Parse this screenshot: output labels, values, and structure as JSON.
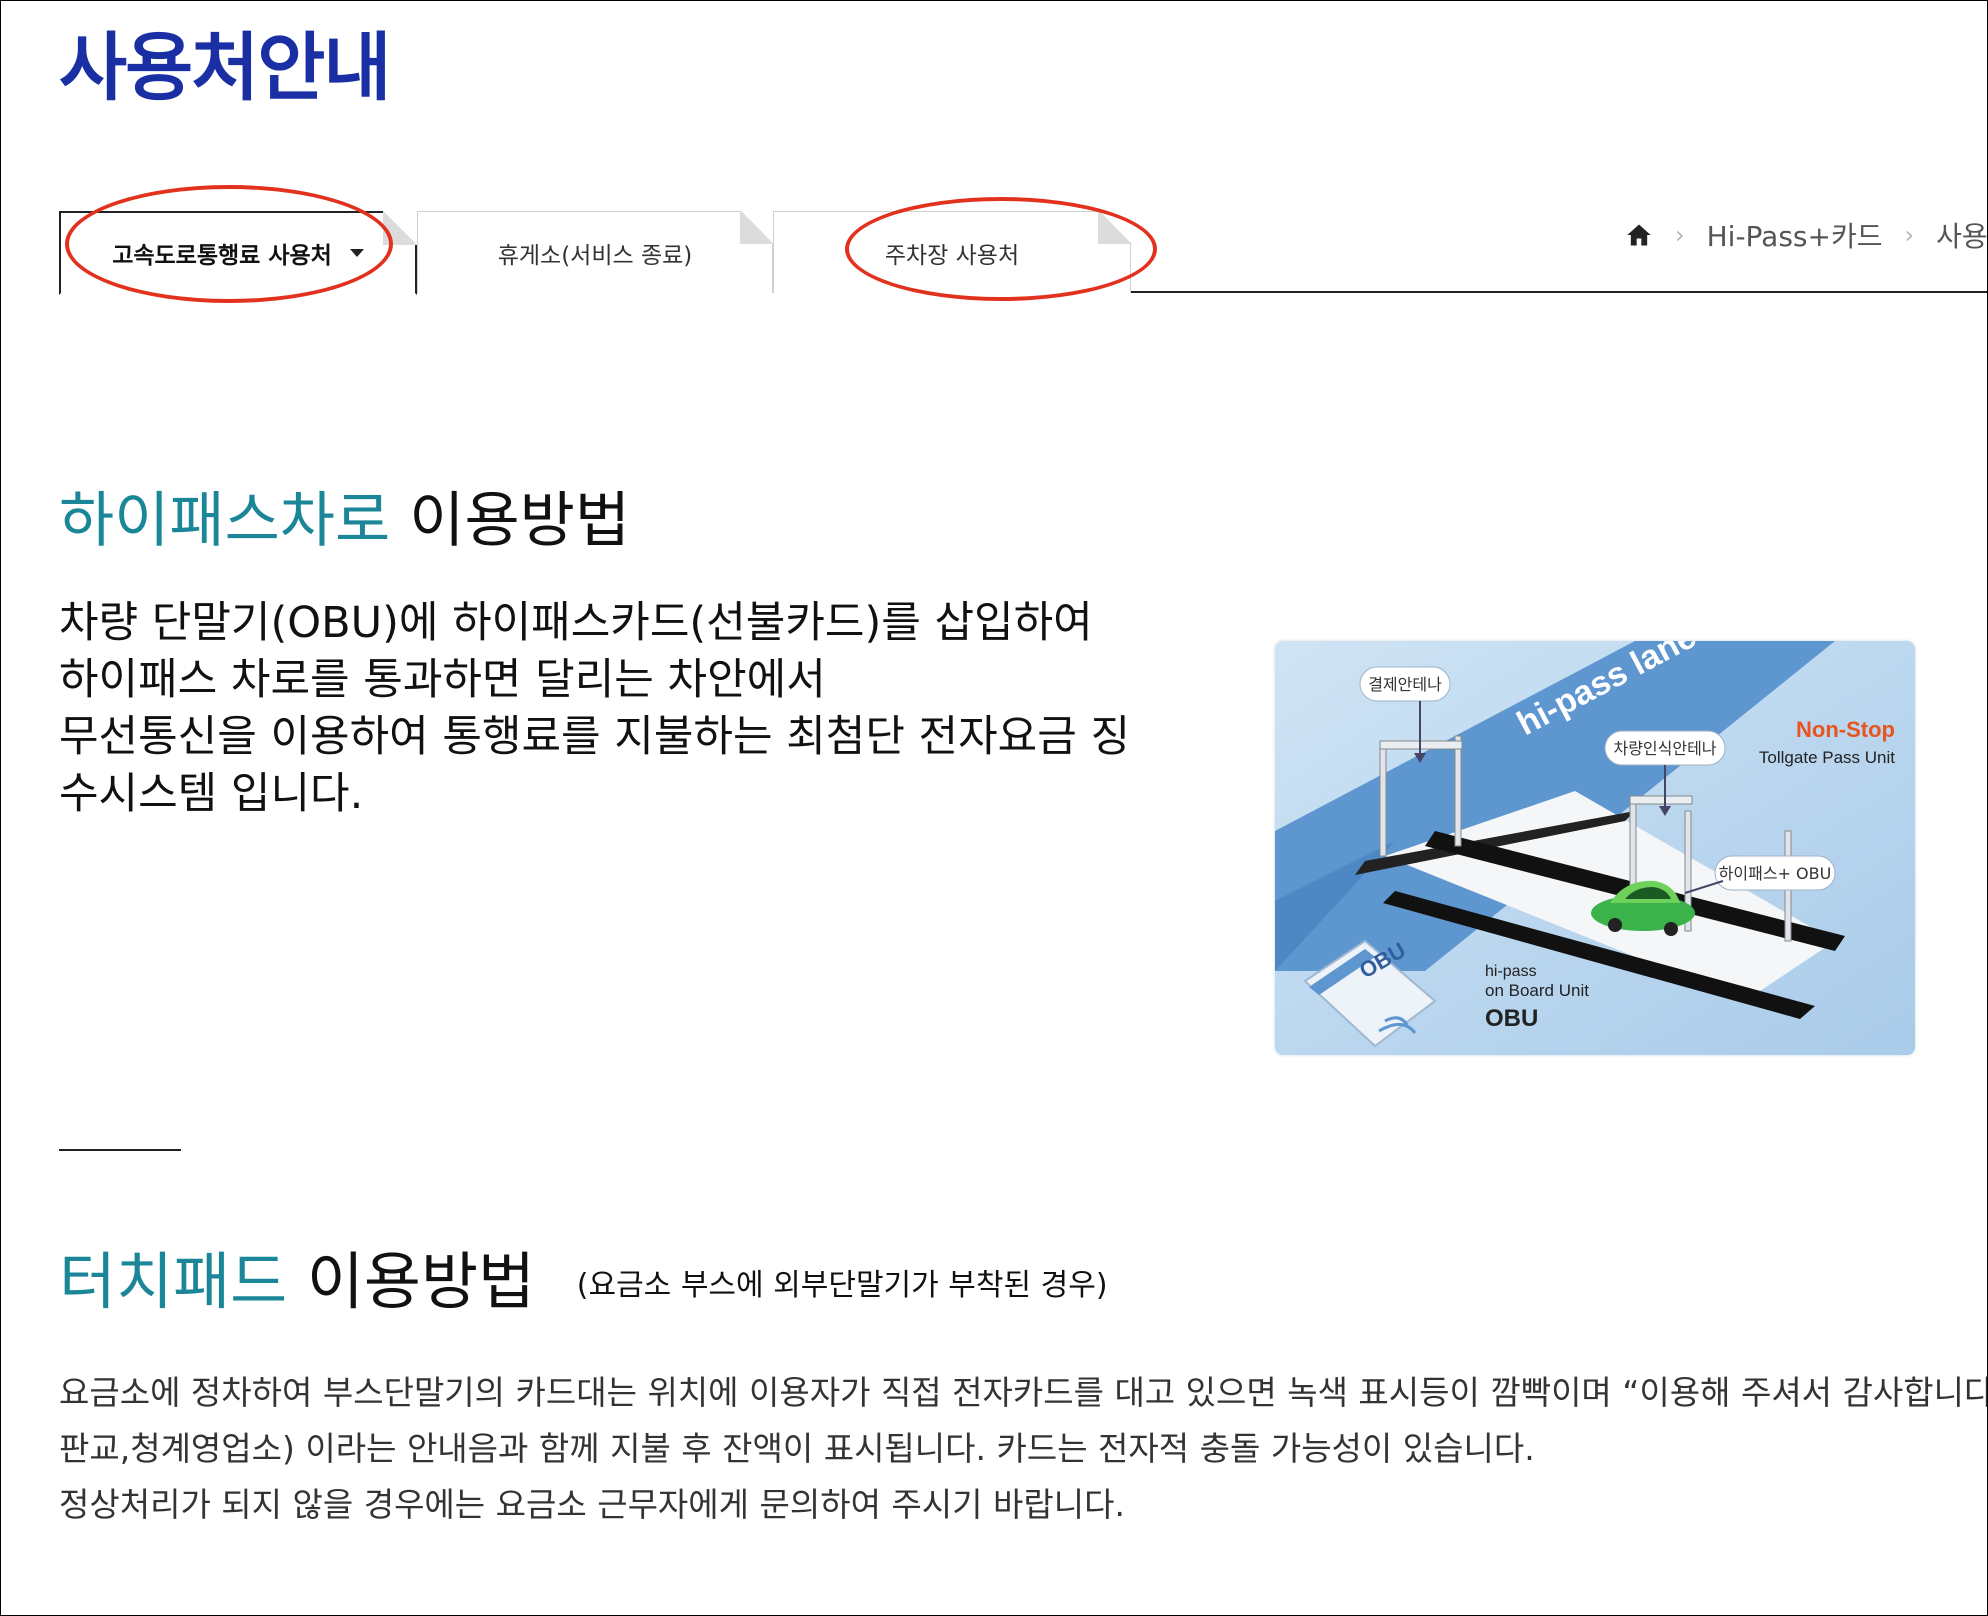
{
  "page_title": "사용처안내",
  "tabs": [
    {
      "label": "고속도로통행료 사용처",
      "active": true,
      "has_dropdown": true
    },
    {
      "label": "휴게소(서비스 종료)",
      "active": false
    },
    {
      "label": "주차장 사용처",
      "active": false
    }
  ],
  "breadcrumb": {
    "home_icon": "home-icon",
    "items": [
      "Hi-Pass+카드",
      "사용처안내"
    ]
  },
  "section1": {
    "heading_highlight": "하이패스차로",
    "heading_rest": "이용방법",
    "body_lines": [
      "차량 단말기(OBU)에 하이패스카드(선불카드)를 삽입하여",
      "하이패스 차로를 통과하면 달리는 차안에서",
      "무선통신을 이용하여 통행료를 지불하는 최첨단 전자요금 징",
      "수시스템 입니다."
    ]
  },
  "illustration": {
    "lane_text": "hi-pass lane",
    "label_payment_antenna": "결제안테나",
    "label_vehicle_antenna": "차량인식안테나",
    "label_obu": "하이패스+ OBU",
    "non_stop": "Non-Stop",
    "tollgate": "Tollgate Pass Unit",
    "card_text": "OBU",
    "obu_line1": "hi-pass",
    "obu_line2": "on Board Unit",
    "obu_line3": "OBU"
  },
  "section2": {
    "heading_highlight": "터치패드",
    "heading_rest": "이용방법",
    "heading_note": "(요금소 부스에 외부단말기가 부착된 경우)",
    "body_lines": [
      "요금소에 정차하여 부스단말기의 카드대는 위치에 이용자가 직접 전자카드를 대고 있으면 녹색 표시등이 깜빡이며 “이용해 주셔서 감사합니다",
      "판교,청계영업소) 이라는 안내음과 함께 지불 후 잔액이 표시됩니다. 카드는 전자적 충돌 가능성이 있습니다.",
      "정상처리가 되지 않을 경우에는 요금소 근무자에게 문의하여 주시기 바랍니다."
    ]
  },
  "colors": {
    "title": "#1a2fa3",
    "highlight": "#1a8698",
    "annotation": "#e2321e",
    "non_stop": "#e8541e"
  }
}
